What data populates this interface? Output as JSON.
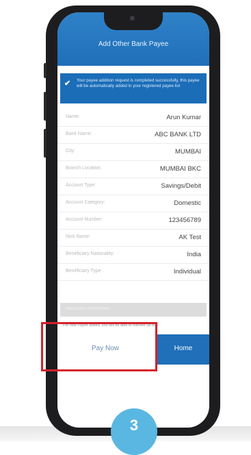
{
  "header": {
    "title": "Add Other Bank Payee"
  },
  "success": {
    "message": "Your payee addition request is completed successfully, this payee will be automatically added in your registered payee list"
  },
  "details": [
    {
      "label": "Name:",
      "value": "Arun Kumar"
    },
    {
      "label": "Bank Name:",
      "value": "ABC BANK  LTD"
    },
    {
      "label": "City:",
      "value": "MUMBAI"
    },
    {
      "label": "Branch Location:",
      "value": "MUMBAI BKC"
    },
    {
      "label": "Account Type:",
      "value": "Savings/Debit"
    },
    {
      "label": "Account Category:",
      "value": "Domestic"
    },
    {
      "label": "Account Number:",
      "value": "123456789"
    },
    {
      "label": "Nick Name:",
      "value": "AK Test"
    },
    {
      "label": "Beneficiary Nationality:",
      "value": "India"
    },
    {
      "label": "Beneficiary Type :",
      "value": "Individual"
    }
  ],
  "grey_bar": {
    "text": "IMMEDIATE INTERBANK"
  },
  "note": {
    "text": "For new Payee added, you will be able to transfer up to ₹"
  },
  "actions": {
    "pay_now": "Pay Now",
    "home": "Home"
  },
  "step": {
    "number": "3"
  },
  "colors": {
    "accent": "#1f6fb9",
    "highlight": "#d6212b",
    "step_badge": "#5ab7e2"
  }
}
